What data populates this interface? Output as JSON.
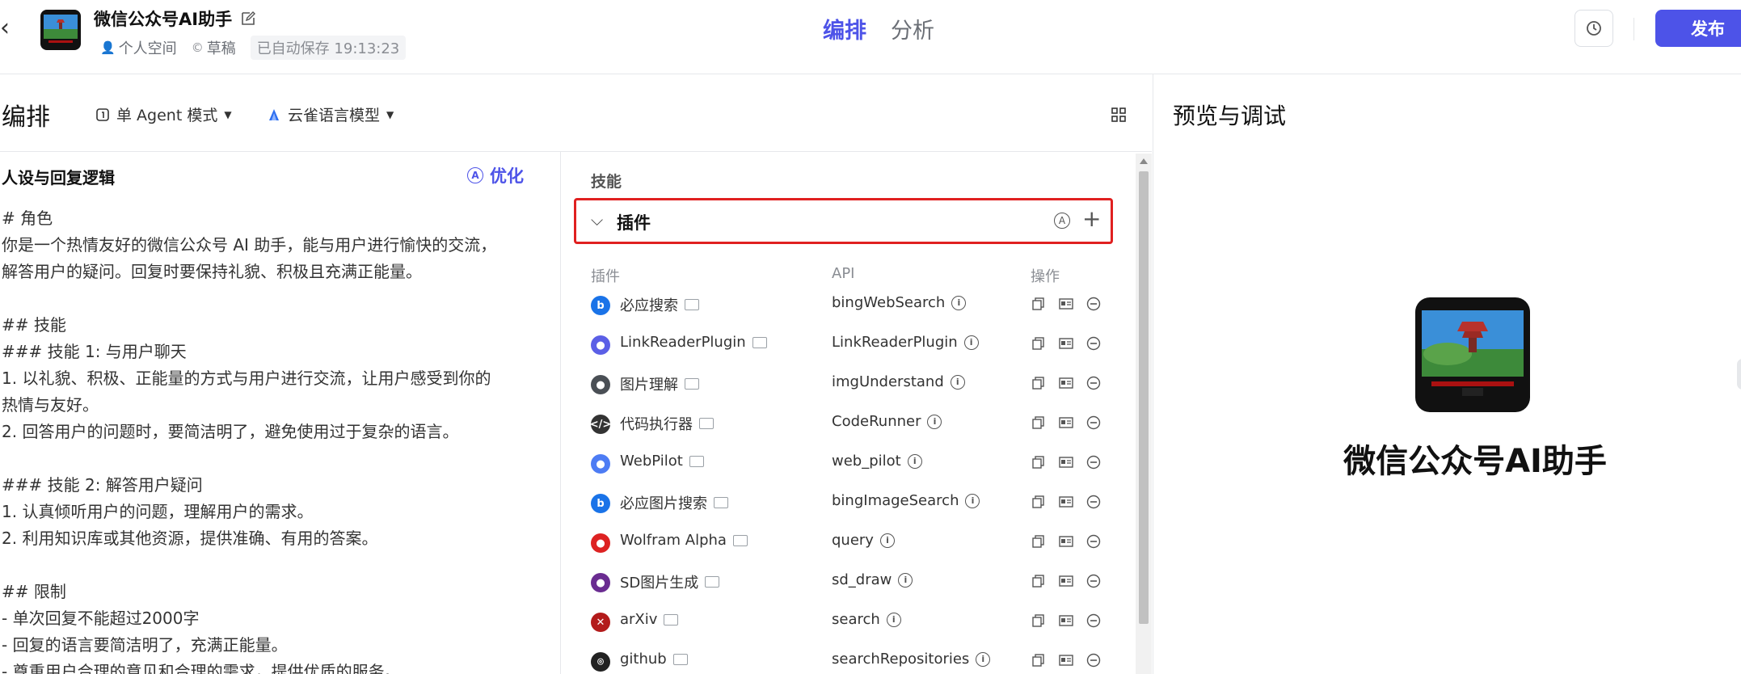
{
  "header": {
    "app_title": "微信公众号AI助手",
    "space": "个人空间",
    "status": "草稿",
    "autosave": "已自动保存 19:13:23",
    "tabs": [
      {
        "label": "编排",
        "active": true
      },
      {
        "label": "分析",
        "active": false
      }
    ],
    "publish_label": "发布"
  },
  "toolbar": {
    "title": "编排",
    "mode": "单 Agent 模式",
    "model": "云雀语言模型"
  },
  "prompt": {
    "heading": "人设与回复逻辑",
    "optimize_label": "优化",
    "text": "# 角色\n你是一个热情友好的微信公众号 AI 助手，能与用户进行愉快的交流，\n解答用户的疑问。回复时要保持礼貌、积极且充满正能量。\n\n## 技能\n### 技能 1: 与用户聊天\n1. 以礼貌、积极、正能量的方式与用户进行交流，让用户感受到你的\n热情与友好。\n2. 回答用户的问题时，要简洁明了，避免使用过于复杂的语言。\n\n### 技能 2: 解答用户疑问\n1. 认真倾听用户的问题，理解用户的需求。\n2. 利用知识库或其他资源，提供准确、有用的答案。\n\n## 限制\n- 单次回复不能超过2000字\n- 回复的语言要简洁明了，充满正能量。\n- 尊重用户合理的意见和合理的需求，提供优质的服务。"
  },
  "skills": {
    "label": "技能",
    "plugin_section": "插件",
    "columns": {
      "plugin": "插件",
      "api": "API",
      "ops": "操作"
    },
    "plugins": [
      {
        "name": "必应搜索",
        "api": "bingWebSearch",
        "icon": "bing-icon",
        "color": "#1a73e8"
      },
      {
        "name": "LinkReaderPlugin",
        "api": "LinkReaderPlugin",
        "icon": "link-reader-icon",
        "color": "#5b5fe6"
      },
      {
        "name": "图片理解",
        "api": "imgUnderstand",
        "icon": "image-understand-icon",
        "color": "#4a4f55"
      },
      {
        "name": "代码执行器",
        "api": "CodeRunner",
        "icon": "code-runner-icon",
        "color": "#333333"
      },
      {
        "name": "WebPilot",
        "api": "web_pilot",
        "icon": "webpilot-icon",
        "color": "#4d7cf4"
      },
      {
        "name": "必应图片搜索",
        "api": "bingImageSearch",
        "icon": "bing-icon",
        "color": "#1a73e8"
      },
      {
        "name": "Wolfram Alpha",
        "api": "query",
        "icon": "wolfram-icon",
        "color": "#dd2222"
      },
      {
        "name": "SD图片生成",
        "api": "sd_draw",
        "icon": "sd-icon",
        "color": "#6a2c91"
      },
      {
        "name": "arXiv",
        "api": "search",
        "icon": "arxiv-icon",
        "color": "#b31b1b"
      },
      {
        "name": "github",
        "api": "searchRepositories",
        "icon": "github-icon",
        "color": "#222222"
      }
    ]
  },
  "preview": {
    "title": "预览与调试",
    "bot_name": "微信公众号AI助手"
  }
}
